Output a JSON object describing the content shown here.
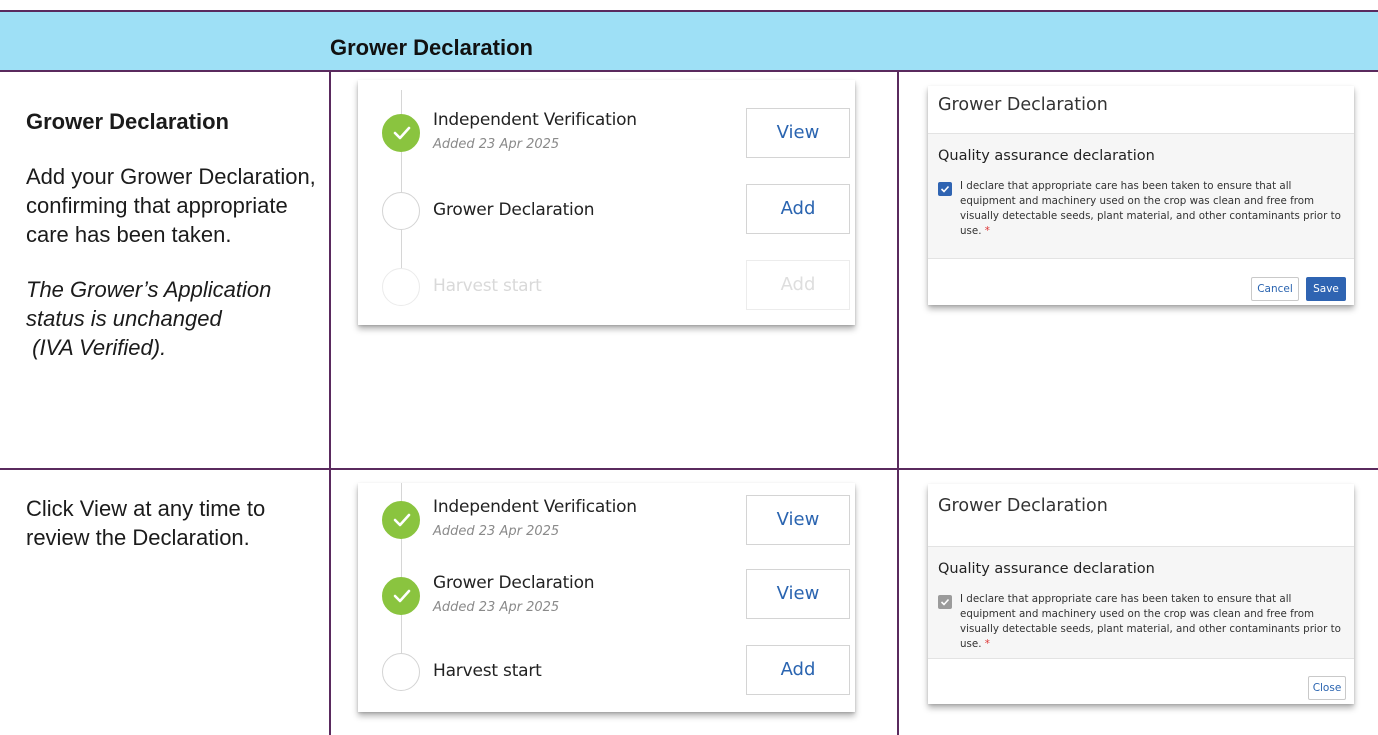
{
  "header": {
    "title": "Grower Declaration"
  },
  "row1": {
    "description": {
      "title": "Grower Declaration",
      "text": "Add your Grower Declaration, confirming that appropriate care has been taken.",
      "note_line1": "The Grower’s Application",
      "note_line2": "status is unchanged",
      "note_line3": " (IVA Verified)."
    },
    "timeline": [
      {
        "name": "Independent Verification",
        "date": "Added 23 Apr 2025",
        "button": "View",
        "state": "done"
      },
      {
        "name": "Grower Declaration",
        "date": "",
        "button": "Add",
        "state": "pending"
      },
      {
        "name": "Harvest start",
        "date": "",
        "button": "Add",
        "state": "disabled"
      }
    ],
    "dialog": {
      "title": "Grower Declaration",
      "section": "Quality assurance declaration",
      "declaration": "I declare that appropriate care has been taken to ensure that all equipment and machinery used on the crop was clean and free from visually detectable seeds, plant material, and other contaminants prior to use.",
      "required_mark": "*",
      "checked": true,
      "cancel_label": "Cancel",
      "save_label": "Save"
    }
  },
  "row2": {
    "description": {
      "text": "Click View at any time to review the Declaration."
    },
    "timeline": [
      {
        "name": "Independent Verification",
        "date": "Added 23 Apr 2025",
        "button": "View",
        "state": "done"
      },
      {
        "name": "Grower Declaration",
        "date": "Added 23 Apr 2025",
        "button": "View",
        "state": "done"
      },
      {
        "name": "Harvest start",
        "date": "",
        "button": "Add",
        "state": "pending"
      }
    ],
    "dialog": {
      "title": "Grower Declaration",
      "section": "Quality assurance declaration",
      "declaration": "I declare that appropriate care has been taken to ensure that all equipment and machinery used on the crop was clean and free from visually detectable seeds, plant material, and other contaminants prior to use.",
      "required_mark": "*",
      "checked": true,
      "close_label": "Close"
    }
  },
  "colors": {
    "header_band": "#9ee0f6",
    "rule": "#5a2a5e",
    "done_green": "#8ac43f",
    "link_blue": "#2a64b0",
    "primary_blue": "#2f64b2"
  },
  "icons": {
    "done": "check-icon",
    "checkbox": "checkbox-checked-icon"
  }
}
